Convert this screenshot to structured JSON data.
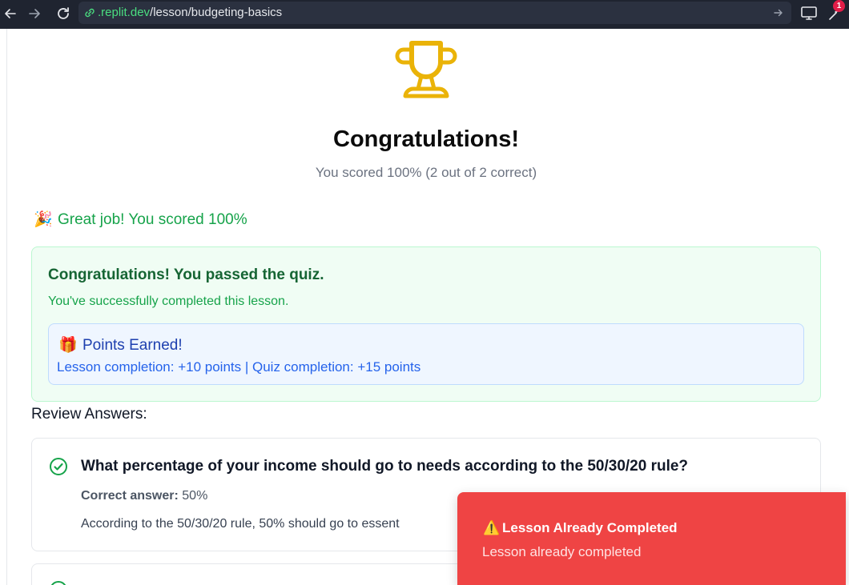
{
  "browser": {
    "url_domain": ".replit.dev",
    "url_path": "/lesson/budgeting-basics",
    "extension_badge": "1"
  },
  "result": {
    "title": "Congratulations!",
    "score_text": "You scored 100% (2 out of 2 correct)",
    "score_percent": 100,
    "great_job_emoji": "🎉",
    "great_job_text": "Great job! You scored 100%"
  },
  "pass_card": {
    "title": "Congratulations! You passed the quiz.",
    "subtitle": "You've successfully completed this lesson.",
    "points_emoji": "🎁",
    "points_title": "Points Earned!",
    "points_detail": "Lesson completion: +10 points | Quiz completion: +15 points"
  },
  "review": {
    "heading": "Review Answers:",
    "questions": [
      {
        "question": "What percentage of your income should go to needs according to the 50/30/20 rule?",
        "answer_label": "Correct answer:",
        "answer_value": "50%",
        "explanation": "According to the 50/30/20 rule, 50% should go to essent"
      }
    ]
  },
  "toast": {
    "icon": "⚠️",
    "title": "Lesson Already Completed",
    "message": "Lesson already completed"
  },
  "colors": {
    "accent_green": "#16a34a",
    "trophy_gold": "#eab308",
    "toast_red": "#ef4444",
    "points_blue": "#2563eb"
  }
}
